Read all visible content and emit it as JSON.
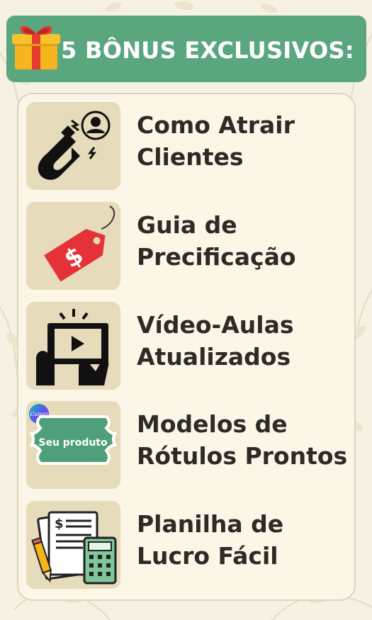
{
  "banner": {
    "title": "5 BÔNUS EXCLUSIVOS:",
    "icon": "gift-box-icon"
  },
  "bonuses": [
    {
      "line1": "Como Atrair",
      "line2": "Clientes",
      "icon": "magnet-attracting-person-icon"
    },
    {
      "line1": "Guia de",
      "line2": "Precificação",
      "icon": "price-tag-icon"
    },
    {
      "line1": "Vídeo-Aulas",
      "line2": "Atualizados",
      "icon": "video-screen-hands-icon"
    },
    {
      "line1": "Modelos de",
      "line2": "Rótulos Prontos",
      "icon": "label-template-icon",
      "label_badge_text": "Seu produto",
      "canva_logo_text": "Canva"
    },
    {
      "line1": "Planilha de",
      "line2": "Lucro Fácil",
      "icon": "spreadsheet-calculator-icon"
    }
  ],
  "colors": {
    "background": "#f6f1e3",
    "banner": "#5aa77f",
    "tile": "#e6dbbb",
    "text": "#2e2a26",
    "tag_red": "#e53238",
    "label_green": "#4f9f7a"
  }
}
